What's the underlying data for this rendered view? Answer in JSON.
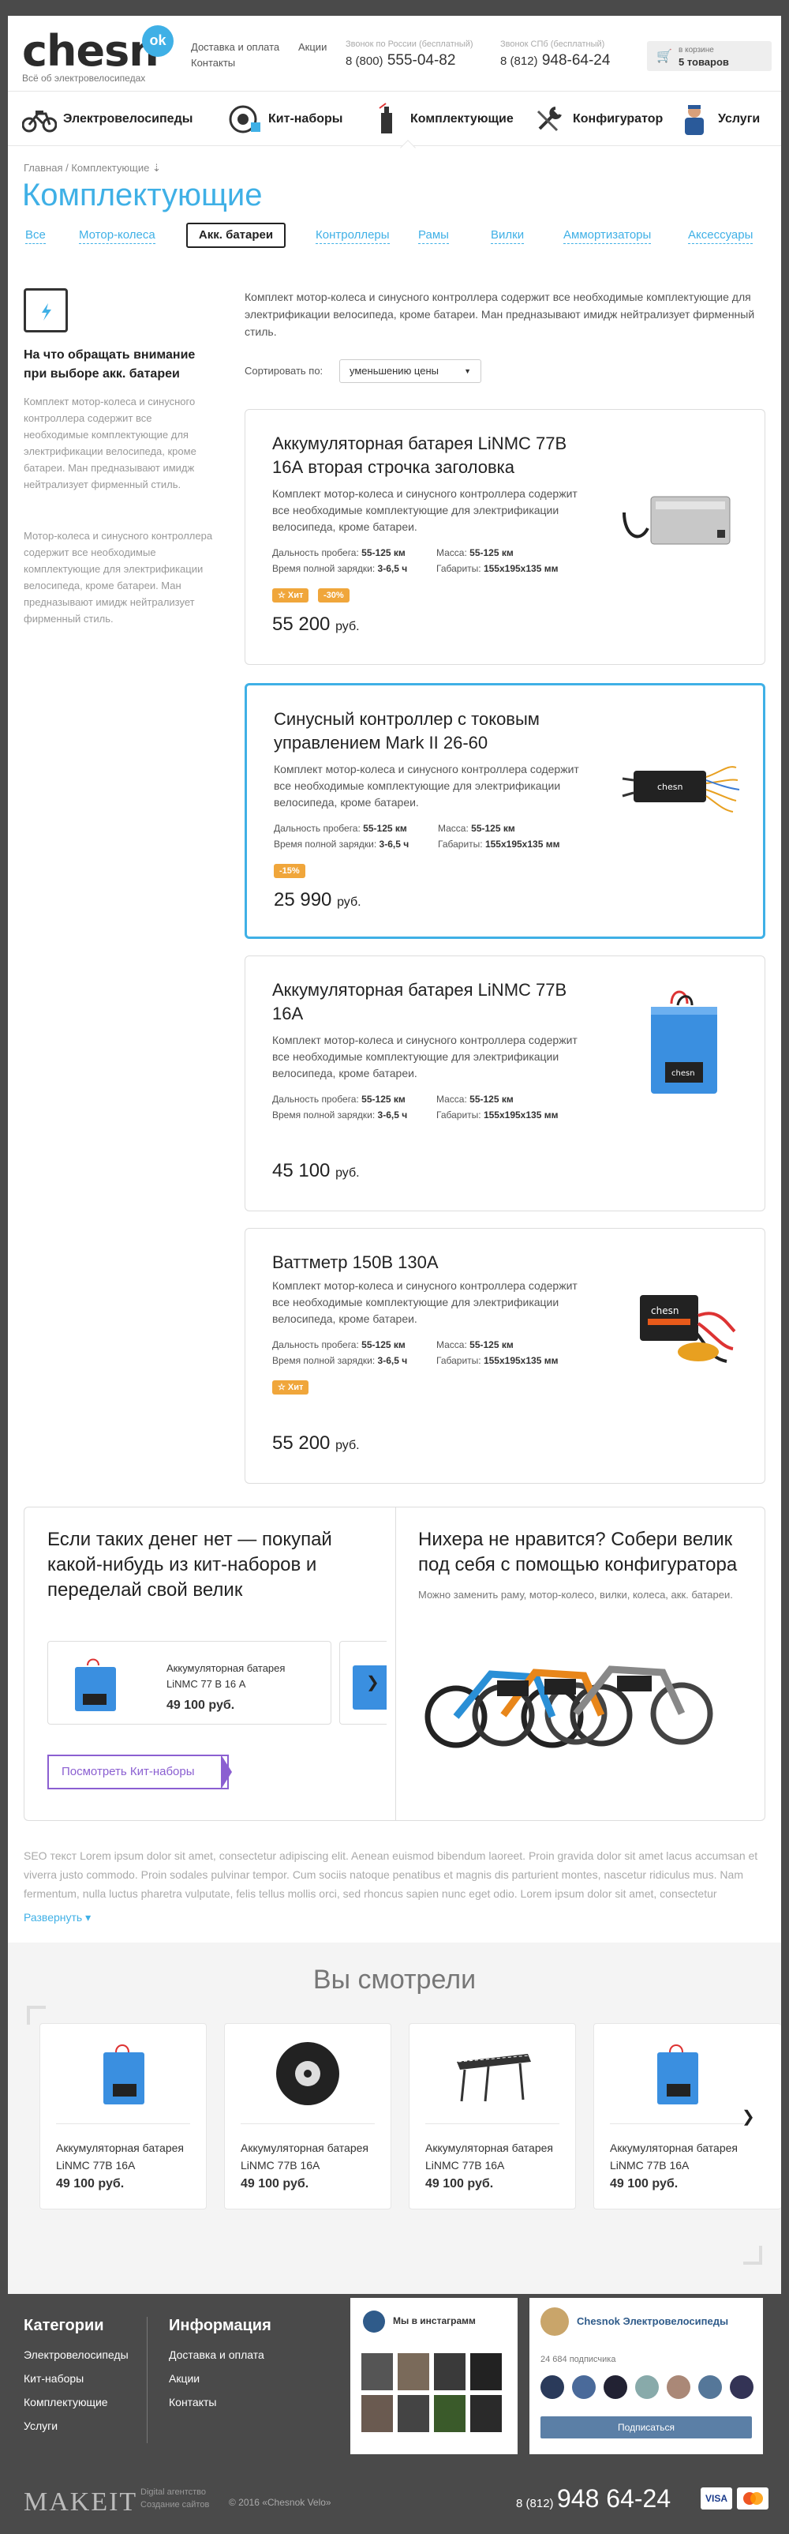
{
  "header": {
    "logo": "chesn",
    "logo_badge": "ok",
    "tagline": "Всё об электровелосипедах",
    "links": [
      "Доставка и оплата",
      "Акции",
      "Контакты"
    ],
    "phone1_caption": "Звонок по России (бесплатный)",
    "phone1_prefix": "8 (800)",
    "phone1_number": "555-04-82",
    "phone2_caption": "Звонок СПб (бесплатный)",
    "phone2_prefix": "8 (812)",
    "phone2_number": "948-64-24",
    "cart_label": "в корзине",
    "cart_count": "5 товаров"
  },
  "nav": [
    "Электровелосипеды",
    "Кит-наборы",
    "Комплектующие",
    "Конфигуратор",
    "Услуги"
  ],
  "breadcrumb": [
    "Главная",
    "Комплектующие"
  ],
  "page_title": "Комплектующие",
  "tabs": [
    "Все",
    "Мотор-колеса",
    "Акк. батареи",
    "Контроллеры",
    "Рамы",
    "Вилки",
    "Аммортизаторы",
    "Аксессуары"
  ],
  "sidebar": {
    "title": "На что обращать внимание при выборе акк. батареи",
    "p1": "Комплект мотор-колеса и синусного контроллера содержит все необходимые комплектующие для электрификации велосипеда, кроме батареи. Ман предназывают имидж нейтрализует фирменный стиль.",
    "p2": "Мотор-колеса и синусного контроллера содержит все необходимые комплектующие для электрификации велосипеда, кроме батареи. Ман предназывают имидж нейтрализует фирменный стиль."
  },
  "intro": "Комплект мотор-колеса и синусного контроллера содержит все необходимые комплектующие для электрификации велосипеда, кроме батареи. Ман предназывают имидж нейтрализует фирменный стиль.",
  "sort": {
    "label": "Сортировать по:",
    "value": "уменьшению цены"
  },
  "spec_labels": {
    "range": "Дальность пробега:",
    "mass": "Масса:",
    "charge": "Время полной зарядки:",
    "size": "Габариты:"
  },
  "products": [
    {
      "title": "Аккумуляторная батарея LiNMC 77В 16А вторая строчка заголовка",
      "desc": "Комплект мотор-колеса и синусного контроллера содержит все необходимые комплектующие для электрификации велосипеда, кроме батареи.",
      "range": "55-125 км",
      "mass": "55-125 км",
      "charge": "3-6,5 ч",
      "size": "155x195x135 мм",
      "badges": [
        "☆ Хит",
        "-30%"
      ],
      "price": "55 200",
      "currency": "руб."
    },
    {
      "title": "Синусный контроллер с токовым управлением Mark II 26-60",
      "desc": "Комплект мотор-колеса и синусного контроллера содержит все необходимые комплектующие для электрификации велосипеда, кроме батареи.",
      "range": "55-125 км",
      "mass": "55-125 км",
      "charge": "3-6,5 ч",
      "size": "155x195x135 мм",
      "badges": [
        "-15%"
      ],
      "price": "25 990",
      "currency": "руб."
    },
    {
      "title": "Аккумуляторная батарея LiNMC 77В 16А",
      "desc": "Комплект мотор-колеса и синусного контроллера содержит все необходимые комплектующие для электрификации велосипеда, кроме батареи.",
      "range": "55-125 км",
      "mass": "55-125 км",
      "charge": "3-6,5 ч",
      "size": "155x195x135 мм",
      "badges": [],
      "price": "45 100",
      "currency": "руб."
    },
    {
      "title": "Ваттметр 150В 130А",
      "desc": "Комплект мотор-колеса и синусного контроллера содержит все необходимые комплектующие для электрификации велосипеда, кроме батареи.",
      "range": "55-125 км",
      "mass": "55-125 км",
      "charge": "3-6,5 ч",
      "size": "155x195x135 мм",
      "badges": [
        "☆ Хит"
      ],
      "price": "55 200",
      "currency": "руб."
    }
  ],
  "promo": {
    "left_title": "Если таких денег нет — покупай какой-нибудь из кит-наборов и переделай свой велик",
    "mini_name": "Аккумуляторная батарея LiNMC 77 В 16 А",
    "mini_price": "49 100 руб.",
    "button": "Посмотреть Кит-наборы",
    "right_title": "Нихера не нравится? Собери велик под себя с помощью конфигуратора",
    "right_desc": "Можно заменить раму, мотор-колесо, вилки, колеса, акк. батареи."
  },
  "seo": {
    "text": "SEO текст Lorem ipsum dolor sit amet, consectetur adipiscing elit. Aenean euismod bibendum laoreet. Proin gravida dolor sit amet lacus accumsan et viverra justo commodo. Proin sodales pulvinar tempor. Cum sociis natoque penatibus et magnis dis parturient montes, nascetur ridiculus mus. Nam fermentum, nulla luctus pharetra vulputate, felis tellus mollis orci, sed rhoncus sapien nunc eget odio. Lorem ipsum dolor sit amet, consectetur",
    "more": "Развернуть ▾"
  },
  "viewed": {
    "title": "Вы смотрели",
    "items": [
      {
        "name": "Аккумуляторная батарея LiNMC 77В 16А",
        "price": "49 100 руб."
      },
      {
        "name": "Аккумуляторная батарея LiNMC 77В 16А",
        "price": "49 100 руб."
      },
      {
        "name": "Аккумуляторная батарея LiNMC 77В 16А",
        "price": "49 100 руб."
      },
      {
        "name": "Аккумуляторная батарея LiNMC 77В 16А",
        "price": "49 100 руб."
      }
    ]
  },
  "footer": {
    "cat_title": "Категории",
    "cats": [
      "Электровелосипеды",
      "Кит-наборы",
      "Комплектующие",
      "Услуги"
    ],
    "info_title": "Информация",
    "info": [
      "Доставка и оплата",
      "Акции",
      "Контакты"
    ],
    "insta_title": "Мы в инстаграмм",
    "vk_title": "Chesnok Электровелосипеды",
    "vk_subs": "24 684 подписчика",
    "vk_button": "Подписаться",
    "maker": "MAKEIT",
    "maker_sub1": "Digital агентство",
    "maker_sub2": "Создание сайтов",
    "copyright": "© 2016 «Chesnok Velo»",
    "phone_prefix": "8 (812)",
    "phone": "948 64-24",
    "pay1": "VISA"
  },
  "colors": {
    "accent": "#3fb0e6",
    "badge": "#f0a63b",
    "purple": "#8b5fd1",
    "footer_bg": "#4a4a4a"
  }
}
